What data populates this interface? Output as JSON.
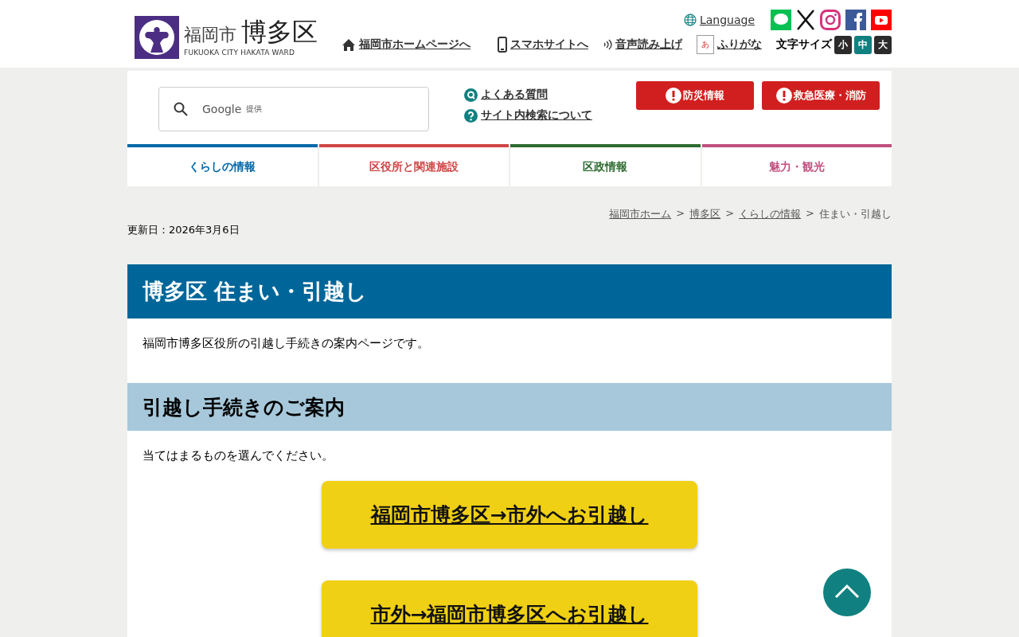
{
  "header": {
    "logo": {
      "city": "福岡市",
      "ward": "博多区",
      "romaji": "FUKUOKA CITY HAKATA WARD"
    },
    "language": "Language",
    "links": [
      {
        "kind": "home",
        "label": "福岡市ホームページへ"
      },
      {
        "kind": "phone",
        "label": "スマホサイトへ"
      },
      {
        "kind": "voice",
        "label": "音声読み上げ"
      },
      {
        "kind": "furigana",
        "label": "ふりがな",
        "icon_char": "あ"
      }
    ],
    "socials": [
      {
        "kind": "line"
      },
      {
        "kind": "x"
      },
      {
        "kind": "instagram"
      },
      {
        "kind": "facebook"
      },
      {
        "kind": "youtube"
      }
    ],
    "font_size": {
      "label": "文字サイズ",
      "options": [
        {
          "label": "小",
          "selected": false
        },
        {
          "label": "中",
          "selected": true
        },
        {
          "label": "大",
          "selected": false
        }
      ]
    }
  },
  "search": {
    "brand": "Google",
    "provided": "提供"
  },
  "help_links": [
    {
      "kind": "q",
      "label": "よくある質問"
    },
    {
      "kind": "help",
      "label": "サイト内検索について"
    }
  ],
  "alerts": [
    "防災情報",
    "救急医療・消防"
  ],
  "tabs": [
    {
      "label": "くらしの情報",
      "color": "#0068a8"
    },
    {
      "label": "区役所と関連施設",
      "color": "#d04545"
    },
    {
      "label": "区政情報",
      "color": "#2e6b30"
    },
    {
      "label": "魅力・観光",
      "color": "#c0507f"
    }
  ],
  "breadcrumb": {
    "separator": ">",
    "links": [
      "福岡市ホーム",
      "博多区",
      "くらしの情報"
    ],
    "current": "住まい・引越し"
  },
  "updated": "更新日：2026年3月6日",
  "page": {
    "title": "博多区 住まい・引越し",
    "intro": "福岡市博多区役所の引越し手続きの案内ページです。",
    "section": "引越し手続きのご案内",
    "prompt": "当てはまるものを選んでください。",
    "choices": [
      "福岡市博多区→市外へお引越し",
      "市外→福岡市博多区へお引越し"
    ]
  }
}
